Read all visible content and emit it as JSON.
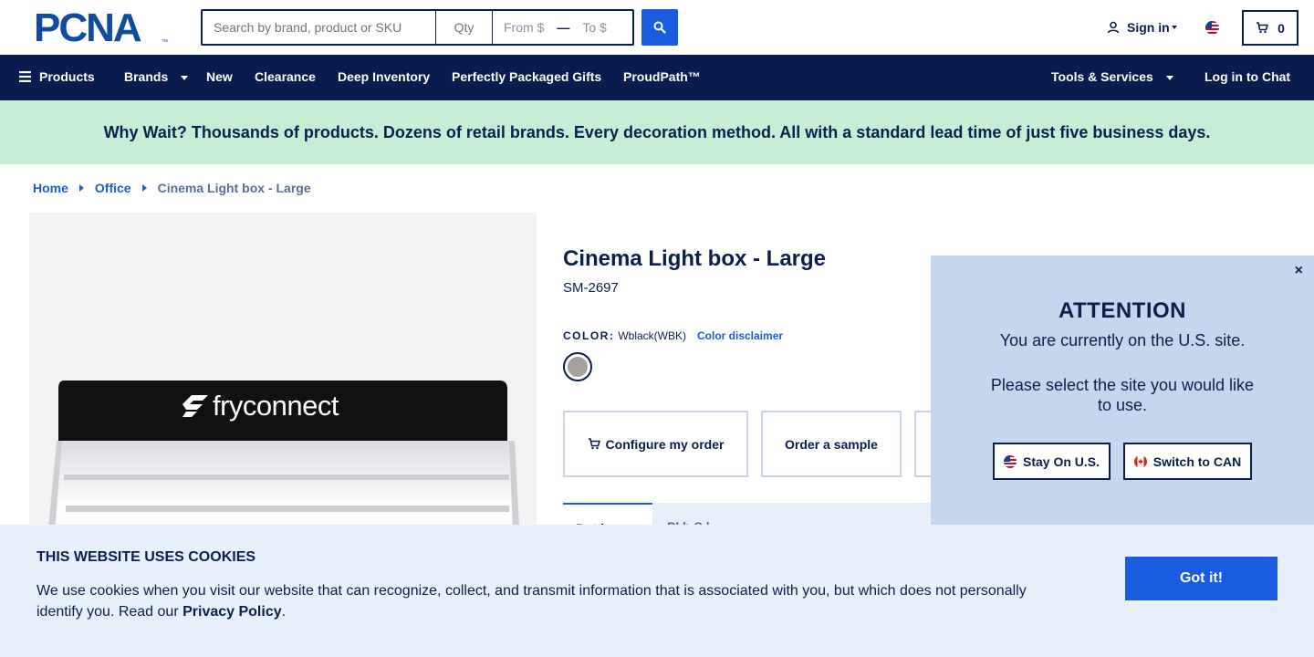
{
  "header": {
    "logo_text": "PCNA",
    "logo_tm": "™",
    "search": {
      "placeholder": "Search by brand, product or SKU"
    },
    "qty": {
      "placeholder": "Qty"
    },
    "price_from": "From $",
    "price_sep": "—",
    "price_to": "To $",
    "sign_in": "Sign in",
    "cart_count": "0"
  },
  "nav": {
    "products": "Products",
    "brands": "Brands",
    "new": "New",
    "clearance": "Clearance",
    "deep_inventory": "Deep Inventory",
    "gifts": "Perfectly Packaged Gifts",
    "proudpath": "ProudPath™",
    "tools": "Tools & Services",
    "chat": "Log in to Chat"
  },
  "promo": "Why Wait? Thousands of products. Dozens of retail brands. Every decoration method. All with a standard lead time of just five business days.",
  "breadcrumb": {
    "home": "Home",
    "office": "Office",
    "current": "Cinema Light box - Large"
  },
  "product": {
    "image_logo_text": "fryconnect",
    "title": "Cinema Light box - Large",
    "sku": "SM-2697",
    "color_label": "COLOR:",
    "color_value": "Wblack(WBK)",
    "color_disclaimer": "Color disclaimer",
    "swatch_color": "#a6a09a",
    "configure": "Configure my order",
    "sample": "Order a sample"
  },
  "tabs": {
    "active": "Pr    t    l",
    "second": "Pl    b       S    l"
  },
  "attention": {
    "close": "×",
    "title": "ATTENTION",
    "line1": "You are currently on the U.S. site.",
    "line2": "Please select the site you would like to use.",
    "stay": "Stay On U.S.",
    "switch": "Switch to CAN"
  },
  "cookie": {
    "title": "THIS WEBSITE USES COOKIES",
    "text": "We use cookies when you visit our website that can recognize, collect, and transmit information that is associated with you, but which does not personally identify you. Read our ",
    "link": "Privacy Policy",
    "period": ".",
    "button": "Got it!"
  },
  "colors": {
    "navy": "#081c50",
    "blue": "#1a5ce0",
    "promo_bg": "#c6eed7",
    "modal_bg": "#c5d6ef",
    "cookie_bg": "#e8f0fb"
  }
}
